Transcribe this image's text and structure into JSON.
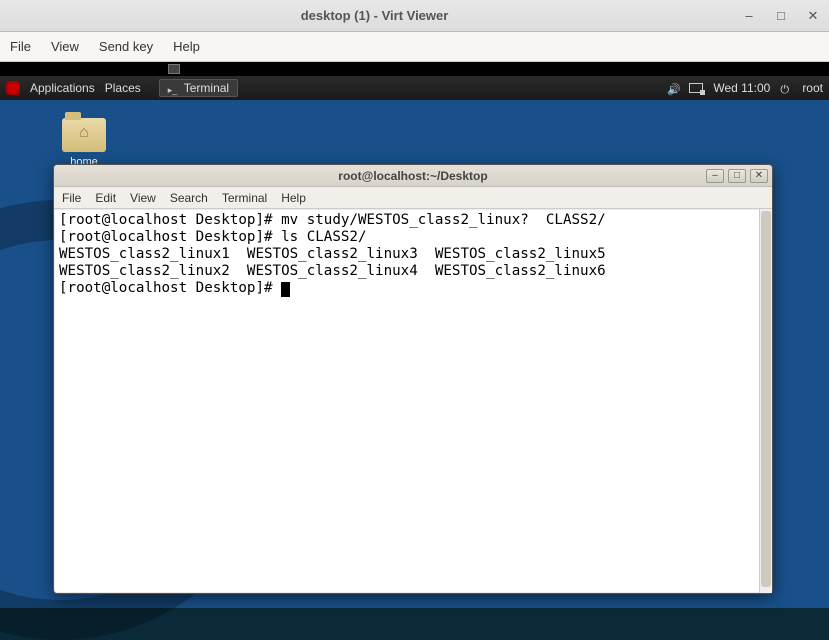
{
  "outer": {
    "title": "desktop (1) - Virt Viewer",
    "menu": [
      "File",
      "View",
      "Send key",
      "Help"
    ]
  },
  "panel": {
    "apps": "Applications",
    "places": "Places",
    "task": "Terminal",
    "clock": "Wed 11:00",
    "user": "root"
  },
  "desktop": {
    "home_label": "home"
  },
  "terminal": {
    "title": "root@localhost:~/Desktop",
    "menu": [
      "File",
      "Edit",
      "View",
      "Search",
      "Terminal",
      "Help"
    ],
    "lines": [
      "[root@localhost Desktop]# mv study/WESTOS_class2_linux?  CLASS2/",
      "[root@localhost Desktop]# ls CLASS2/",
      "WESTOS_class2_linux1  WESTOS_class2_linux3  WESTOS_class2_linux5",
      "WESTOS_class2_linux2  WESTOS_class2_linux4  WESTOS_class2_linux6",
      "[root@localhost Desktop]# "
    ]
  }
}
